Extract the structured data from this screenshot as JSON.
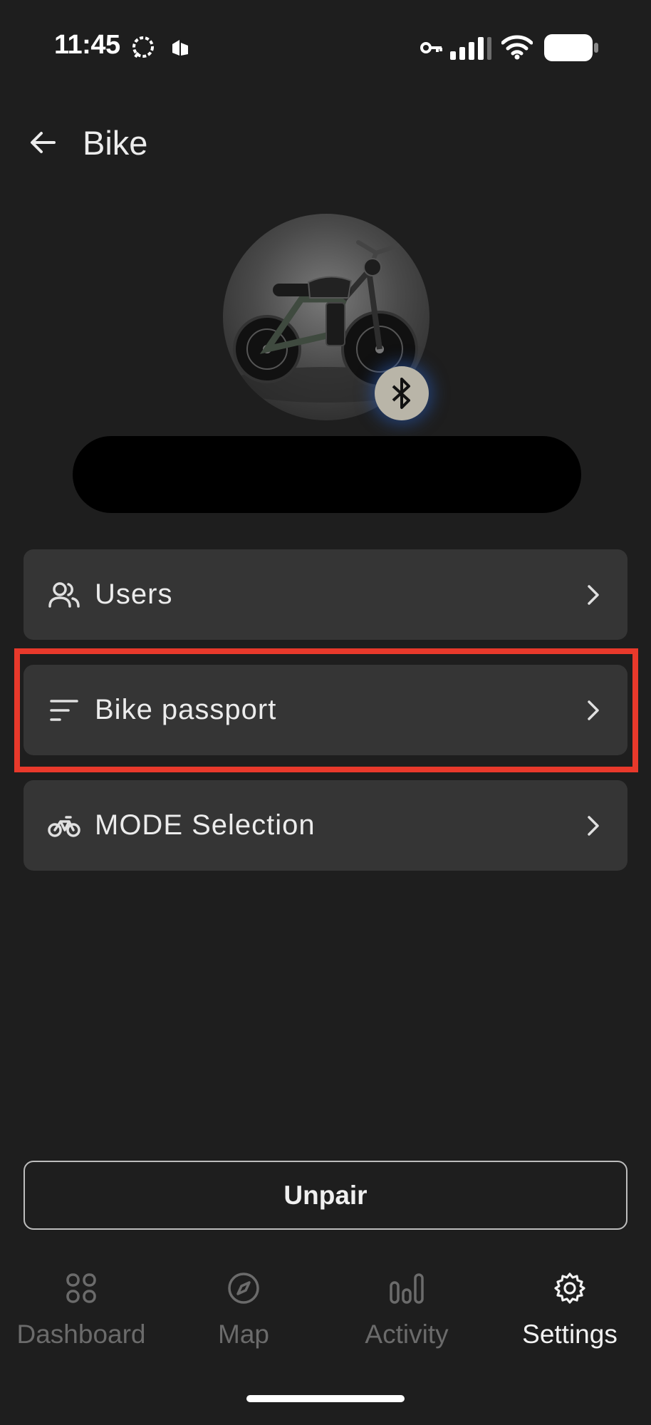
{
  "status_bar": {
    "time": "11:45",
    "icons": [
      "chat-bubble-icon",
      "notification-app-icon",
      "vpn-key-icon",
      "cellular-signal-icon",
      "wifi-icon",
      "battery-icon"
    ]
  },
  "header": {
    "back_icon": "arrow-left-icon",
    "title": "Bike"
  },
  "bike": {
    "avatar": "bike-photo",
    "connection_icon": "bluetooth-icon",
    "name": ""
  },
  "menu": [
    {
      "label": "Users",
      "icon": "users-icon"
    },
    {
      "label": "Bike passport",
      "icon": "sort-lines-icon",
      "highlighted": true
    },
    {
      "label": "MODE Selection",
      "icon": "bicycle-icon"
    }
  ],
  "actions": {
    "unpair_label": "Unpair"
  },
  "bottom_nav": [
    {
      "label": "Dashboard",
      "icon": "grid-icon",
      "active": false
    },
    {
      "label": "Map",
      "icon": "compass-icon",
      "active": false
    },
    {
      "label": "Activity",
      "icon": "bar-chart-icon",
      "active": false
    },
    {
      "label": "Settings",
      "icon": "gear-icon",
      "active": true
    }
  ],
  "colors": {
    "background": "#1e1e1e",
    "card": "#353535",
    "highlight": "#e8392b",
    "inactive_nav": "#6b6b6b",
    "active_nav": "#f2f2f2",
    "badge": "#b9b5a8"
  }
}
